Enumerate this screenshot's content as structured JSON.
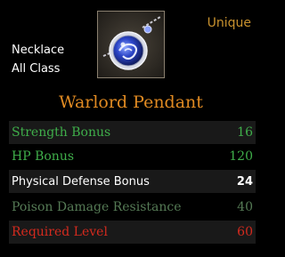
{
  "item": {
    "type": "Necklace",
    "class": "All Class",
    "rarity": "Unique",
    "name": "Warlord Pendant",
    "icon": "pendant-icon"
  },
  "stats": [
    {
      "label": "Strength Bonus",
      "value": "16",
      "color": "#3fae4a"
    },
    {
      "label": "HP Bonus",
      "value": "120",
      "color": "#3fae4a"
    },
    {
      "label": "Physical Defense Bonus",
      "value": "24",
      "color": "#ffffff"
    },
    {
      "label": "Poison Damage Resistance",
      "value": "40",
      "color": "#557a55"
    },
    {
      "label": "Required Level",
      "value": "60",
      "color": "#d42a1e"
    }
  ],
  "colors": {
    "rarity": "#c9922e",
    "name": "#e08a22"
  }
}
